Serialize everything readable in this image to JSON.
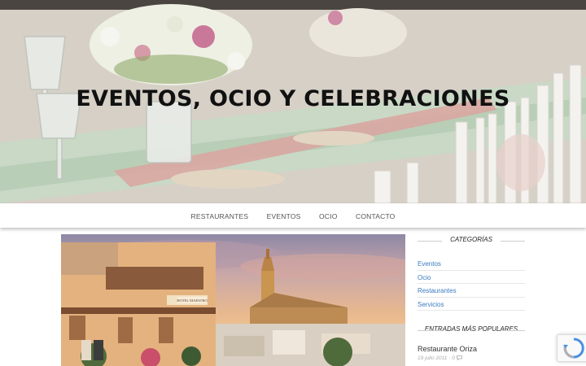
{
  "hero": {
    "title": "EVENTOS, OCIO Y CELEBRACIONES"
  },
  "nav": {
    "items": [
      "RESTAURANTES",
      "EVENTOS",
      "OCIO",
      "CONTACTO"
    ]
  },
  "sidebar": {
    "categories_heading": "CATEGORÍAS",
    "categories": [
      "Eventos",
      "Ocio",
      "Restaurantes",
      "Servicios"
    ],
    "popular_heading": "ENTRADAS MÁS POPULARES",
    "popular": [
      {
        "title": "Restaurante Oriza",
        "date": "19 julio 2011",
        "comments": "0",
        "icon": "comment-icon"
      }
    ]
  },
  "feature_image": {
    "sign_text": "HOTEL MAESTRO"
  },
  "colors": {
    "link": "#3a7bbf",
    "text": "#222222",
    "recaptcha_blue": "#4a90e2"
  }
}
